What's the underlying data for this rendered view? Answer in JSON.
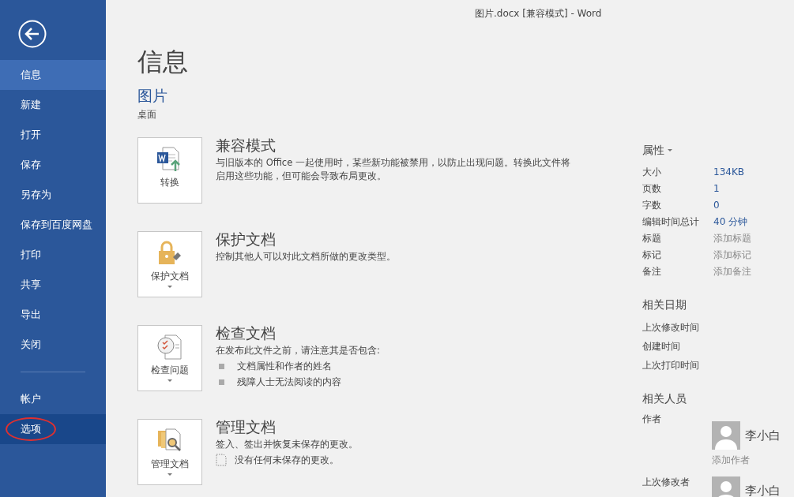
{
  "window": {
    "title": "图片.docx [兼容模式] - Word"
  },
  "sidebar": {
    "items": [
      {
        "label": "信息",
        "selected": true,
        "highlighted": false,
        "circled": false
      },
      {
        "label": "新建",
        "selected": false,
        "highlighted": false,
        "circled": false
      },
      {
        "label": "打开",
        "selected": false,
        "highlighted": false,
        "circled": false
      },
      {
        "label": "保存",
        "selected": false,
        "highlighted": false,
        "circled": false
      },
      {
        "label": "另存为",
        "selected": false,
        "highlighted": false,
        "circled": false
      },
      {
        "label": "保存到百度网盘",
        "selected": false,
        "highlighted": false,
        "circled": false
      },
      {
        "label": "打印",
        "selected": false,
        "highlighted": false,
        "circled": false
      },
      {
        "label": "共享",
        "selected": false,
        "highlighted": false,
        "circled": false
      },
      {
        "label": "导出",
        "selected": false,
        "highlighted": false,
        "circled": false
      },
      {
        "label": "关闭",
        "selected": false,
        "highlighted": false,
        "circled": false
      }
    ],
    "bottom_items": [
      {
        "label": "帐户",
        "selected": false,
        "highlighted": false,
        "circled": false
      },
      {
        "label": "选项",
        "selected": false,
        "highlighted": true,
        "circled": true
      }
    ]
  },
  "page_title": "信息",
  "document": {
    "name": "图片",
    "location": "桌面"
  },
  "sections": [
    {
      "kind": "convert",
      "button": "转换",
      "dropdown": false,
      "title": "兼容模式",
      "description": "与旧版本的 Office 一起使用时，某些新功能被禁用，以防止出现问题。转换此文件将启用这些功能，但可能会导致布局更改。"
    },
    {
      "kind": "protect",
      "button": "保护文档",
      "dropdown": true,
      "title": "保护文档",
      "description": "控制其他人可以对此文档所做的更改类型。"
    },
    {
      "kind": "inspect",
      "button": "检查问题",
      "dropdown": true,
      "title": "检查文档",
      "description": "在发布此文件之前，请注意其是否包含:",
      "bullets": [
        "文档属性和作者的姓名",
        "残障人士无法阅读的内容"
      ]
    },
    {
      "kind": "manage",
      "button": "管理文档",
      "dropdown": true,
      "title": "管理文档",
      "description": "签入、签出并恢复未保存的更改。",
      "note": "没有任何未保存的更改。"
    }
  ],
  "properties": {
    "title": "属性",
    "rows": [
      {
        "label": "大小",
        "value": "134KB",
        "placeholder": false
      },
      {
        "label": "页数",
        "value": "1",
        "placeholder": false
      },
      {
        "label": "字数",
        "value": "0",
        "placeholder": false
      },
      {
        "label": "编辑时间总计",
        "value": "40 分钟",
        "placeholder": false
      },
      {
        "label": "标题",
        "value": "添加标题",
        "placeholder": true
      },
      {
        "label": "标记",
        "value": "添加标记",
        "placeholder": true
      },
      {
        "label": "备注",
        "value": "添加备注",
        "placeholder": true
      }
    ]
  },
  "related_dates": {
    "title": "相关日期",
    "rows": [
      "上次修改时间",
      "创建时间",
      "上次打印时间"
    ]
  },
  "related_people": {
    "title": "相关人员",
    "author_label": "作者",
    "author": "李小白",
    "add_author": "添加作者",
    "last_modified_label": "上次修改者",
    "last_modified_by": "李小白"
  }
}
